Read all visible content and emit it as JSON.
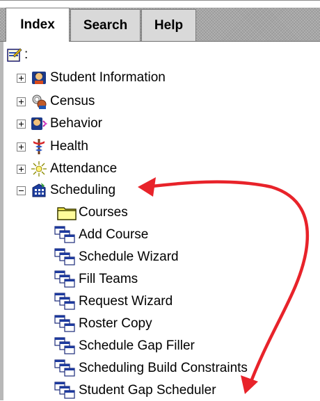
{
  "tabs": [
    {
      "label": "Index",
      "active": true
    },
    {
      "label": "Search",
      "active": false
    },
    {
      "label": "Help",
      "active": false
    }
  ],
  "root": {
    "label": ":",
    "icon": "checklist-icon"
  },
  "tree": [
    {
      "label": "Student Information",
      "expanded": false,
      "icon": "student-information-icon"
    },
    {
      "label": "Census",
      "expanded": false,
      "icon": "census-icon"
    },
    {
      "label": "Behavior",
      "expanded": false,
      "icon": "behavior-icon"
    },
    {
      "label": "Health",
      "expanded": false,
      "icon": "health-icon"
    },
    {
      "label": "Attendance",
      "expanded": false,
      "icon": "attendance-icon"
    },
    {
      "label": "Scheduling",
      "expanded": true,
      "icon": "scheduling-icon"
    }
  ],
  "scheduling_children": [
    {
      "label": "Courses",
      "icon": "folder-icon"
    },
    {
      "label": "Add Course",
      "icon": "window-stack-icon"
    },
    {
      "label": "Schedule Wizard",
      "icon": "window-stack-icon"
    },
    {
      "label": "Fill Teams",
      "icon": "window-stack-icon"
    },
    {
      "label": "Request Wizard",
      "icon": "window-stack-icon"
    },
    {
      "label": "Roster Copy",
      "icon": "window-stack-icon"
    },
    {
      "label": "Schedule Gap Filler",
      "icon": "window-stack-icon"
    },
    {
      "label": "Scheduling Build Constraints",
      "icon": "window-stack-icon"
    },
    {
      "label": "Student Gap Scheduler",
      "icon": "window-stack-icon"
    }
  ],
  "colors": {
    "annotation_arrow": "#e8232a",
    "tab_strip": "#9a9a9a"
  }
}
